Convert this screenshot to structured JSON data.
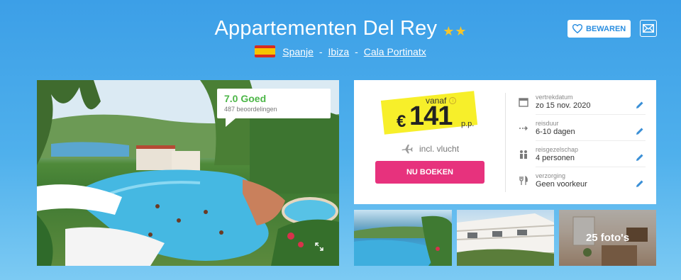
{
  "header": {
    "title": "Appartementen Del Rey",
    "stars": 2,
    "location": {
      "country": "Spanje",
      "island": "Ibiza",
      "town": "Cala Portinatx",
      "separator": "-"
    },
    "save_label": "BEWAREN"
  },
  "rating": {
    "score_label": "7.0 Goed",
    "count": "487 beoordelingen"
  },
  "pricing": {
    "prefix": "vanaf",
    "currency": "€",
    "amount": "141",
    "suffix": "p.p.",
    "includes": "incl. vlucht",
    "book_label": "NU BOEKEN"
  },
  "details": [
    {
      "label": "vertrekdatum",
      "value": "zo 15 nov. 2020",
      "icon": "calendar-icon"
    },
    {
      "label": "reisduur",
      "value": "6-10 dagen",
      "icon": "duration-arrow-icon"
    },
    {
      "label": "reisgezelschap",
      "value": "4 personen",
      "icon": "people-icon"
    },
    {
      "label": "verzorging",
      "value": "Geen voorkeur",
      "icon": "cutlery-icon"
    }
  ],
  "gallery": {
    "photo_count": "25 foto's"
  },
  "colors": {
    "background": "#3c9fe7",
    "accent_blue": "#2a8ee0",
    "book_pink": "#e7327d",
    "price_yellow": "#f7ef2a",
    "rating_green": "#4cb647",
    "star_gold": "#f6c52b"
  }
}
